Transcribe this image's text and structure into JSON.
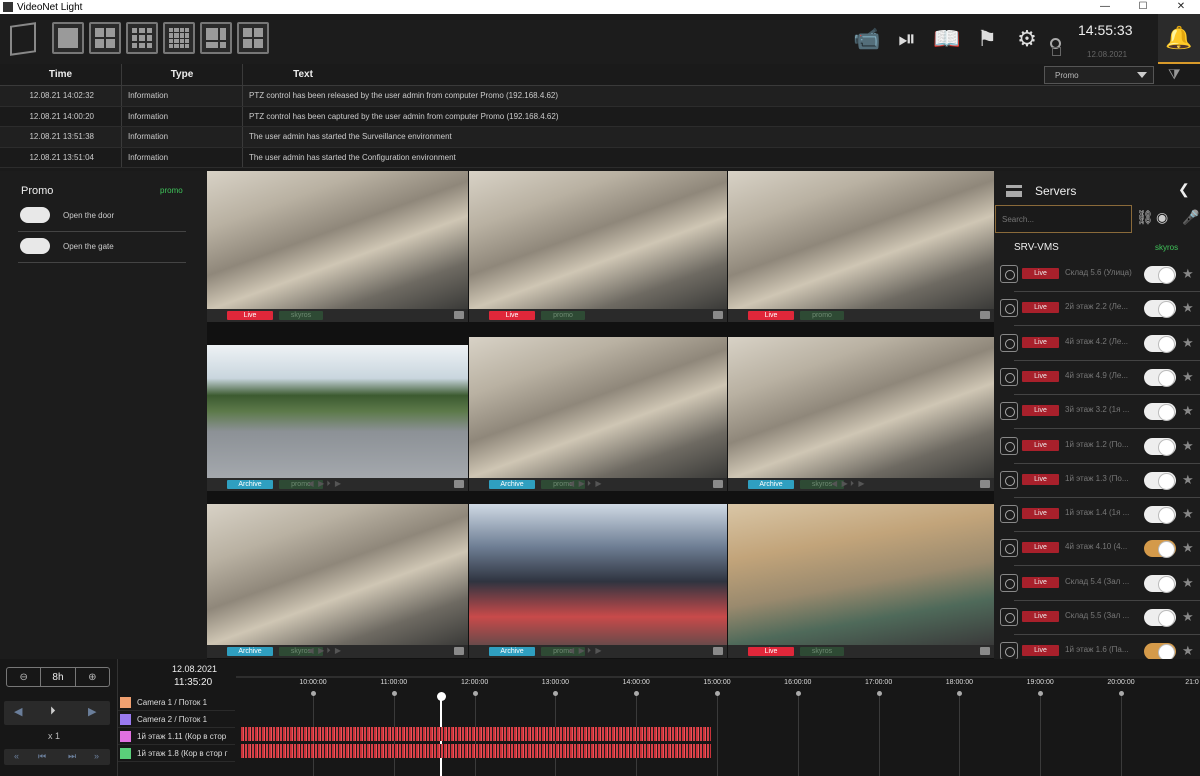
{
  "window": {
    "title": "VideoNet Light",
    "controls": [
      "—",
      "☐",
      "✕"
    ]
  },
  "toolbar": {
    "layouts": [
      "1x1",
      "2x2",
      "3x3",
      "4x4",
      "1+5",
      "2+..."
    ],
    "icons": [
      "ptz-camera-icon",
      "play-circle-icon",
      "book-icon",
      "flags-icon",
      "gear-icon"
    ],
    "clock": "14:55:33",
    "date": "12.08.2021"
  },
  "events": {
    "columns": {
      "time": "Time",
      "type": "Type",
      "text": "Text"
    },
    "filter_value": "Promo",
    "rows": [
      {
        "time": "12.08.21 14:02:32",
        "type": "Information",
        "text": "PTZ control has been released by the user admin from computer Promo (192.168.4.62)"
      },
      {
        "time": "12.08.21 14:00:20",
        "type": "Information",
        "text": "PTZ control has been captured by the user admin from computer Promo (192.168.4.62)"
      },
      {
        "time": "12.08.21 13:51:38",
        "type": "Information",
        "text": "The user admin has started the Surveillance environment"
      },
      {
        "time": "12.08.21 13:51:04",
        "type": "Information",
        "text": "The user admin has started the Configuration environment"
      }
    ]
  },
  "left_panel": {
    "title": "Promo",
    "tag": "promo",
    "actions": [
      {
        "label": "Open the door"
      },
      {
        "label": "Open the gate"
      }
    ]
  },
  "grid": {
    "cells": [
      {
        "mode": "Live",
        "server": "skyros",
        "scene": "factory"
      },
      {
        "mode": "Live",
        "server": "promo",
        "scene": "factory"
      },
      {
        "mode": "Live",
        "server": "promo",
        "scene": "factory"
      },
      {
        "mode": "Archive",
        "server": "promo",
        "scene": "street"
      },
      {
        "mode": "Archive",
        "server": "promo",
        "scene": "factory"
      },
      {
        "mode": "Archive",
        "server": "skyros",
        "scene": "factory"
      },
      {
        "mode": "Archive",
        "server": "skyros",
        "scene": "factory"
      },
      {
        "mode": "Archive",
        "server": "promo",
        "scene": "crowd"
      },
      {
        "mode": "Live",
        "server": "skyros",
        "scene": "warehouse"
      }
    ]
  },
  "right_panel": {
    "title": "Servers",
    "search_placeholder": "Search...",
    "server_name": "SRV-VMS",
    "server_tag": "skyros",
    "cameras": [
      {
        "status": "Live",
        "name": "Склад 5.6 (Улица)",
        "on": false
      },
      {
        "status": "Live",
        "name": "2й этаж 2.2 (Ле...",
        "on": false
      },
      {
        "status": "Live",
        "name": "4й этаж 4.2 (Ле...",
        "on": false
      },
      {
        "status": "Live",
        "name": "4й этаж 4.9 (Ле...",
        "on": false
      },
      {
        "status": "Live",
        "name": "3й этаж 3.2 (1я ...",
        "on": false
      },
      {
        "status": "Live",
        "name": "1й этаж 1.2 (По...",
        "on": false
      },
      {
        "status": "Live",
        "name": "1й этаж 1.3 (По...",
        "on": false
      },
      {
        "status": "Live",
        "name": "1й этаж 1.4 (1я ...",
        "on": false
      },
      {
        "status": "Live",
        "name": "4й этаж 4.10 (4...",
        "on": true
      },
      {
        "status": "Live",
        "name": "Склад 5.4 (Зал ...",
        "on": false
      },
      {
        "status": "Live",
        "name": "Склад 5.5 (Зал ...",
        "on": false
      },
      {
        "status": "Live",
        "name": "1й этаж 1.6 (Па...",
        "on": true
      }
    ]
  },
  "timeline": {
    "zoom": "8h",
    "date": "12.08.2021",
    "time": "11:35:20",
    "speed": "x 1",
    "channels": [
      {
        "name": "Camera 1 / Поток 1",
        "color": "#f0a070"
      },
      {
        "name": "Camera 2 / Поток 1",
        "color": "#9a7af0"
      },
      {
        "name": "1й этаж 1.11 (Кор в стор",
        "color": "#e070e0"
      },
      {
        "name": "1й этаж 1.8 (Кор в стор г",
        "color": "#5ad07a"
      }
    ],
    "ticks": [
      "10:00:00",
      "11:00:00",
      "12:00:00",
      "13:00:00",
      "14:00:00",
      "15:00:00",
      "16:00:00",
      "17:00:00",
      "18:00:00",
      "19:00:00",
      "20:00:00",
      "21:0"
    ]
  }
}
